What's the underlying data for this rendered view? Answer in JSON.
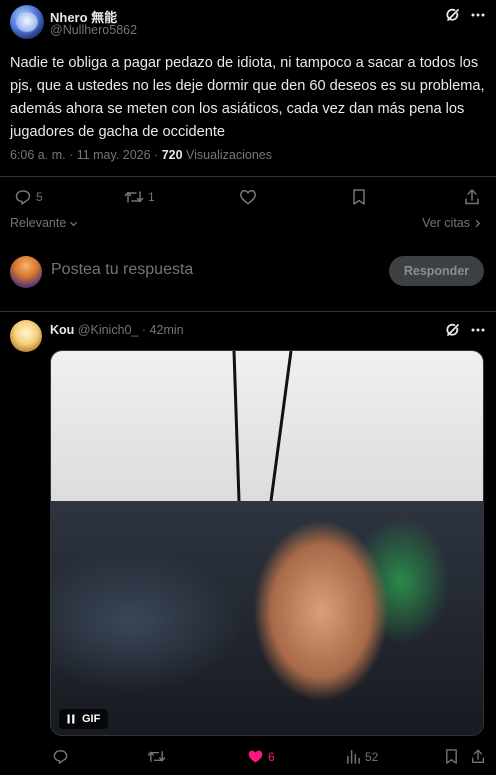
{
  "main_tweet": {
    "author_name": "Nhero 無能",
    "author_handle": "@Nullhero5862",
    "text": "Nadie te obliga a pagar pedazo de idiota, ni tampoco a sacar a todos los pjs, que a ustedes no les deje dormir que den 60 deseos es su problema, además ahora se meten con los asiáticos, cada vez dan más pena los jugadores de gacha de occidente",
    "timestamp": "6:06 a. m. · 11 may. 2026 · ",
    "views_count": "720",
    "views_label": " Visualizaciones",
    "replies_count": "5",
    "reposts_count": "1"
  },
  "sort": {
    "label": "Relevante",
    "quotes_label": "Ver citas"
  },
  "composer": {
    "placeholder": "Postea tu respuesta",
    "button_label": "Responder"
  },
  "reply": {
    "author_name": "Kou",
    "author_handle": "@Kinich0_",
    "time": " · 42min",
    "gif_label": "GIF",
    "likes_count": "6",
    "views_count": "52"
  },
  "colors": {
    "background": "#000000",
    "text": "#e7e9ea",
    "muted": "#71767b",
    "divider": "#2f3336",
    "like_active": "#f91880"
  },
  "icons": [
    "grok-icon",
    "more-icon",
    "reply-icon",
    "repost-icon",
    "like-icon",
    "bookmark-icon",
    "share-icon",
    "views-icon",
    "pause-icon",
    "chevron-down-icon",
    "chevron-right-icon"
  ]
}
